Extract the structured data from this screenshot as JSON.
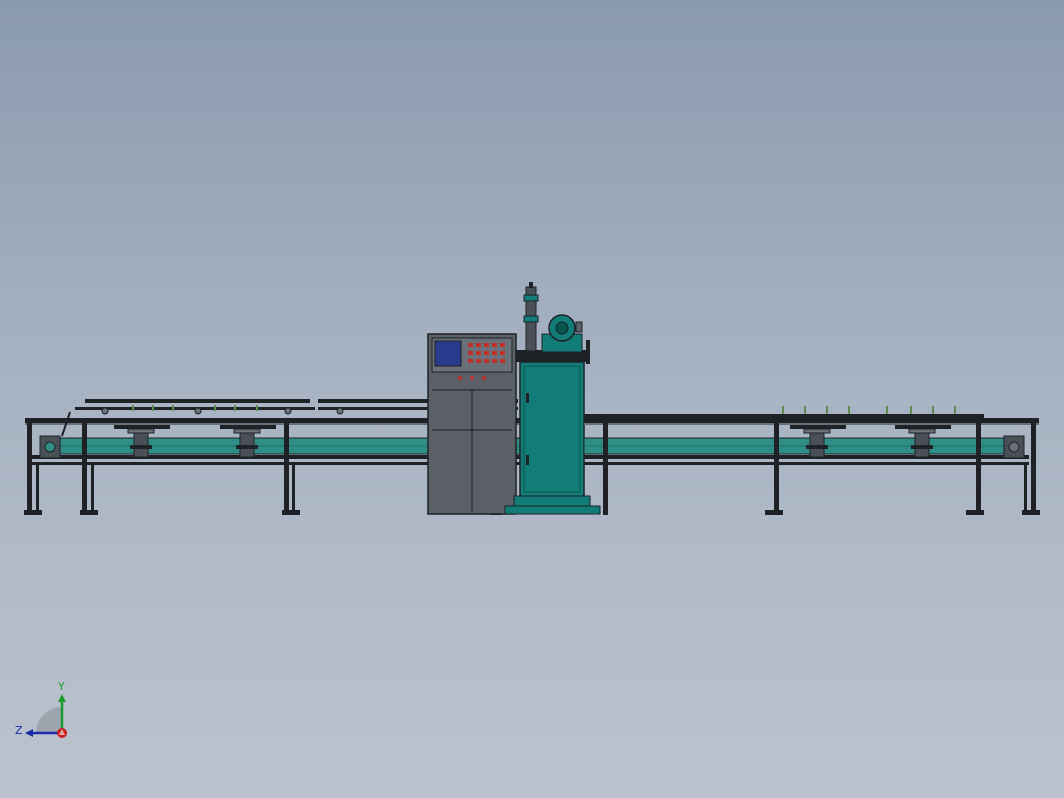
{
  "view": {
    "background_top": "#8a9aad",
    "background_bottom": "#bcc3cf"
  },
  "machine": {
    "frame_color": "#1e2226",
    "belt_color": "#2f8f86",
    "cabinet_color": "#127d78",
    "control_box_color": "#5b6068",
    "screen_color": "#2a3a8c",
    "button_color": "#c0302a"
  },
  "triad": {
    "y_label": "Y",
    "z_label": "Z",
    "y_color": "#1a9a2a",
    "z_color": "#1a2aa8",
    "x_color": "#c82020"
  }
}
